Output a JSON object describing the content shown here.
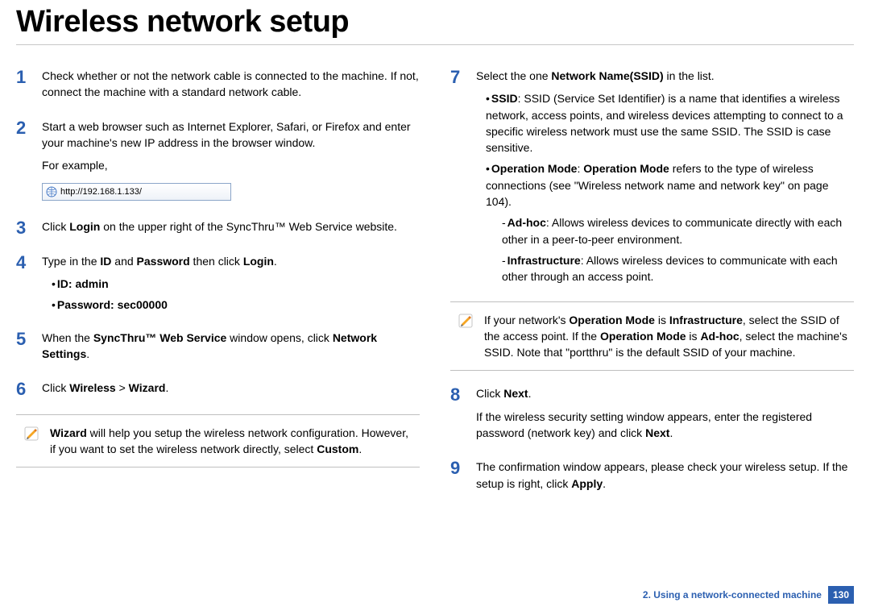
{
  "title": "Wireless network setup",
  "left": {
    "step1": "Check whether or not the network cable is connected to the machine. If not, connect the machine with a standard network cable.",
    "step2_a": "Start a web browser such as Internet Explorer, Safari, or Firefox and enter your machine's new IP address in the browser window.",
    "step2_b": "For example,",
    "url_example": "http://192.168.1.133/",
    "step3_pre": "Click ",
    "step3_bold": "Login",
    "step3_post": " on the upper right of the SyncThru™ Web Service website.",
    "step4_pre": "Type in the ",
    "step4_b1": "ID",
    "step4_mid1": " and ",
    "step4_b2": "Password",
    "step4_mid2": " then click ",
    "step4_b3": "Login",
    "step4_post": ".",
    "step4_id": "ID: admin",
    "step4_pw": "Password: sec00000",
    "step5_pre": "When the ",
    "step5_b1": "SyncThru™ Web Service",
    "step5_mid": " window opens, click ",
    "step5_b2": "Network Settings",
    "step5_post": ".",
    "step6_pre": "Click ",
    "step6_b1": "Wireless",
    "step6_mid": " > ",
    "step6_b2": "Wizard",
    "step6_post": ".",
    "note_b1": "Wizard",
    "note_mid": " will help you setup the wireless network configuration. However, if you want to set the wireless network directly, select ",
    "note_b2": "Custom",
    "note_post": "."
  },
  "right": {
    "step7_pre": "Select the one ",
    "step7_b": "Network Name(SSID)",
    "step7_post": " in the list.",
    "ssid_b": "SSID",
    "ssid_text": ": SSID (Service Set Identifier) is a name that identifies a wireless network, access points, and wireless devices attempting to connect to a specific wireless network must use the same SSID. The SSID is case sensitive.",
    "opmode_b1": "Operation Mode",
    "opmode_mid": ": ",
    "opmode_b2": "Operation Mode",
    "opmode_text": " refers to the type of wireless connections (see \"Wireless network name and network key\" on page 104).",
    "adhoc_b": "Ad-hoc",
    "adhoc_text": ": Allows wireless devices to communicate directly with each other in a peer-to-peer environment.",
    "infra_b": "Infrastructure",
    "infra_text": ": Allows wireless devices to communicate with each other through an access point.",
    "note2_pre": "If your network's ",
    "note2_b1": "Operation Mode",
    "note2_mid1": " is ",
    "note2_b2": "Infrastructure",
    "note2_mid2": ", select the SSID of the access point. If the ",
    "note2_b3": "Operation Mode",
    "note2_mid3": " is ",
    "note2_b4": "Ad-hoc",
    "note2_post": ", select the machine's SSID. Note that \"portthru\" is the default SSID of your machine.",
    "step8_pre": "Click ",
    "step8_b": "Next",
    "step8_post": ".",
    "step8_line2_pre": "If the wireless security setting window appears, enter the registered password (network key) and click ",
    "step8_line2_b": "Next",
    "step8_line2_post": ".",
    "step9_pre": "The confirmation window appears, please check your wireless setup. If the setup is right, click ",
    "step9_b": "Apply",
    "step9_post": "."
  },
  "footer": {
    "chapter": "2.  Using a network-connected machine",
    "page": "130"
  },
  "nums": {
    "n1": "1",
    "n2": "2",
    "n3": "3",
    "n4": "4",
    "n5": "5",
    "n6": "6",
    "n7": "7",
    "n8": "8",
    "n9": "9"
  }
}
